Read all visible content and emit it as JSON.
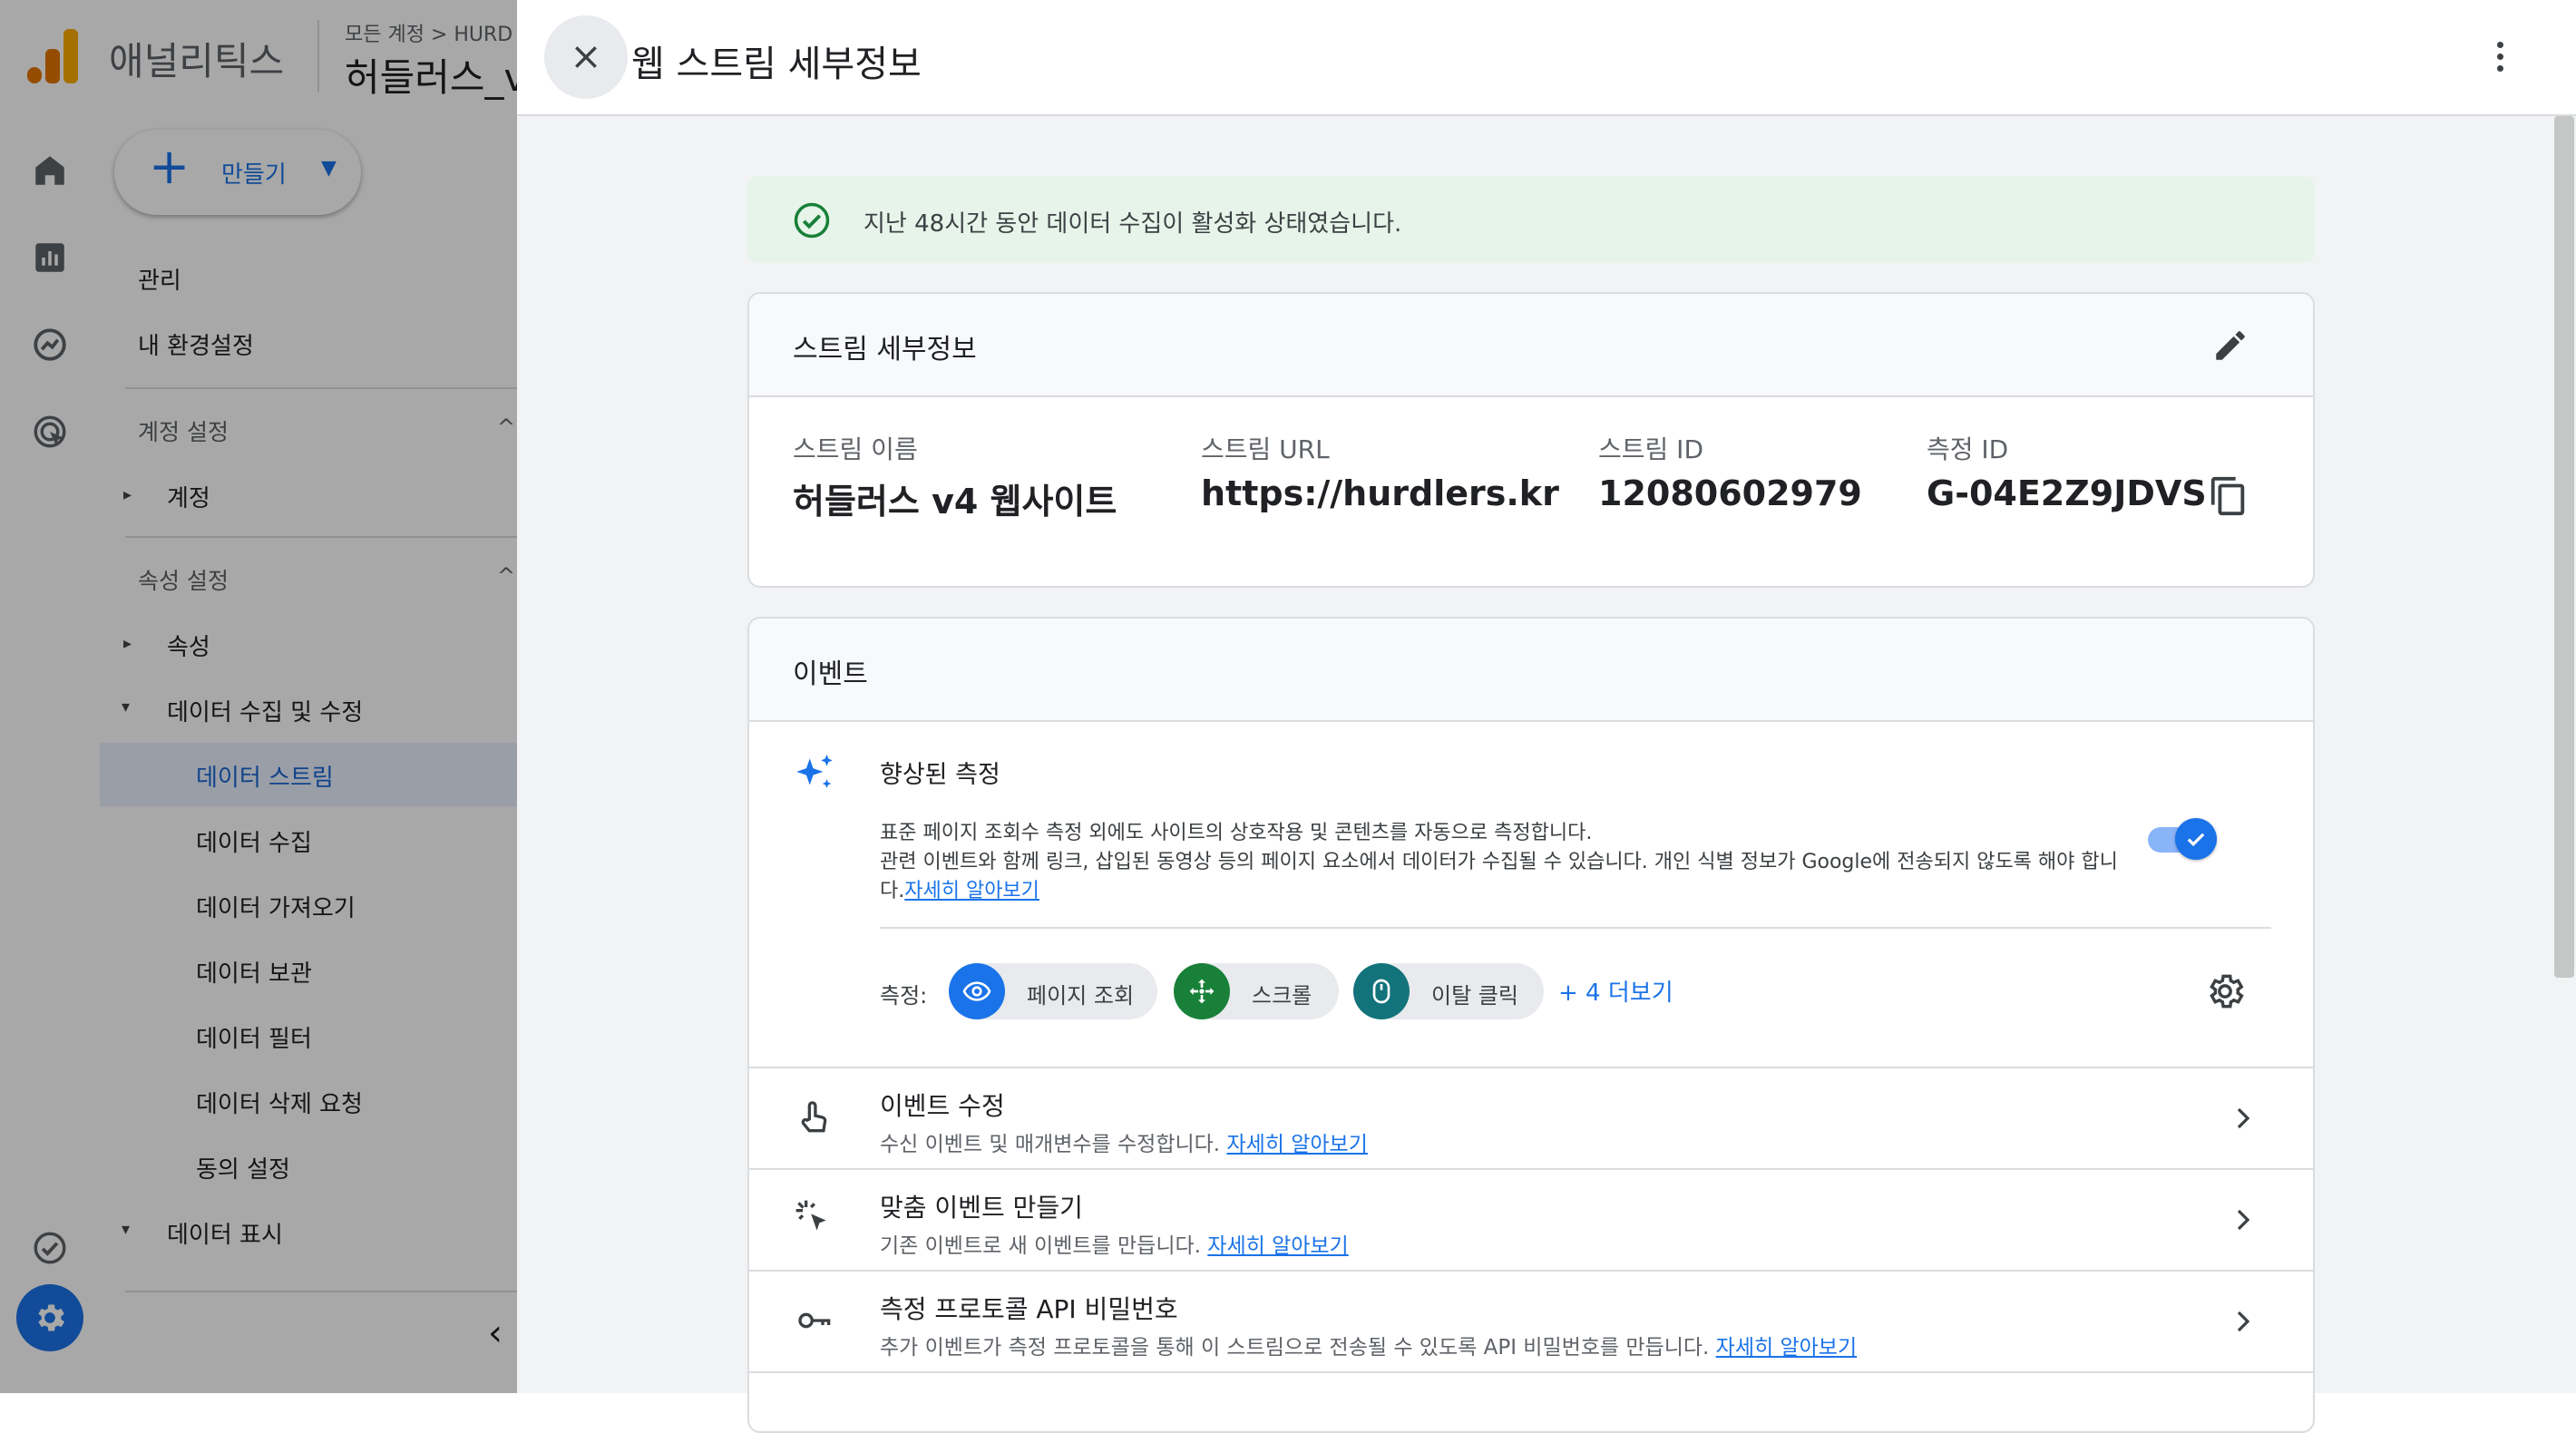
{
  "app": {
    "product_name": "애널리틱스",
    "breadcrumb": "모든 계정 > HURD",
    "property_name": "허들러스_v"
  },
  "nav": {
    "create_label": "만들기",
    "admin": "관리",
    "my_settings": "내 환경설정",
    "account_settings_header": "계정 설정",
    "account": "계정",
    "property_settings_header": "속성 설정",
    "property": "속성",
    "data_collection_group": "데이터 수집 및 수정",
    "items": [
      "데이터 스트림",
      "데이터 수집",
      "데이터 가져오기",
      "데이터 보관",
      "데이터 필터",
      "데이터 삭제 요청",
      "동의 설정"
    ],
    "data_display": "데이터 표시"
  },
  "drawer": {
    "title": "웹 스트림 세부정보",
    "status_message": "지난 48시간 동안 데이터 수집이 활성화 상태였습니다.",
    "stream_details": {
      "header": "스트림 세부정보",
      "name_label": "스트림 이름",
      "name_value": "허들러스 v4 웹사이트",
      "url_label": "스트림 URL",
      "url_value": "https://hurdlers.kr",
      "id_label": "스트림 ID",
      "id_value": "12080602979",
      "measurement_label": "측정 ID",
      "measurement_value": "G-04E2Z9JDVS"
    },
    "events": {
      "header": "이벤트",
      "enhanced_title": "향상된 측정",
      "enhanced_desc_1": "표준 페이지 조회수 측정 외에도 사이트의 상호작용 및 콘텐츠를 자동으로 측정합니다.",
      "enhanced_desc_2": "관련 이벤트와 함께 링크, 삽입된 동영상 등의 페이지 요소에서 데이터가 수집될 수 있습니다. 개인 식별 정보가 Google에 전송되지 않도록 해야 합니",
      "enhanced_desc_3": "다.",
      "learn_more": "자세히 알아보기",
      "toggle_on": true,
      "measure_label": "측정:",
      "chips": [
        {
          "label": "페이지 조회",
          "color": "#1a73e8",
          "icon": "eye-icon"
        },
        {
          "label": "스크롤",
          "color": "#188038",
          "icon": "move-icon"
        },
        {
          "label": "이탈 클릭",
          "color": "#12737b",
          "icon": "mouse-icon"
        }
      ],
      "more_label": "+ 4 더보기",
      "rows": [
        {
          "title": "이벤트 수정",
          "desc": "수신 이벤트 및 매개변수를 수정합니다.",
          "link": "자세히 알아보기",
          "icon": "touch-icon"
        },
        {
          "title": "맞춤 이벤트 만들기",
          "desc": "기존 이벤트로 새 이벤트를 만듭니다.",
          "link": "자세히 알아보기",
          "icon": "click-sparkle-icon"
        },
        {
          "title": "측정 프로토콜 API 비밀번호",
          "desc": "추가 이벤트가 측정 프로토콜을 통해 이 스트림으로 전송될 수 있도록 API 비밀번호를 만듭니다.",
          "link": "자세히 알아보기",
          "icon": "key-icon"
        }
      ]
    }
  }
}
